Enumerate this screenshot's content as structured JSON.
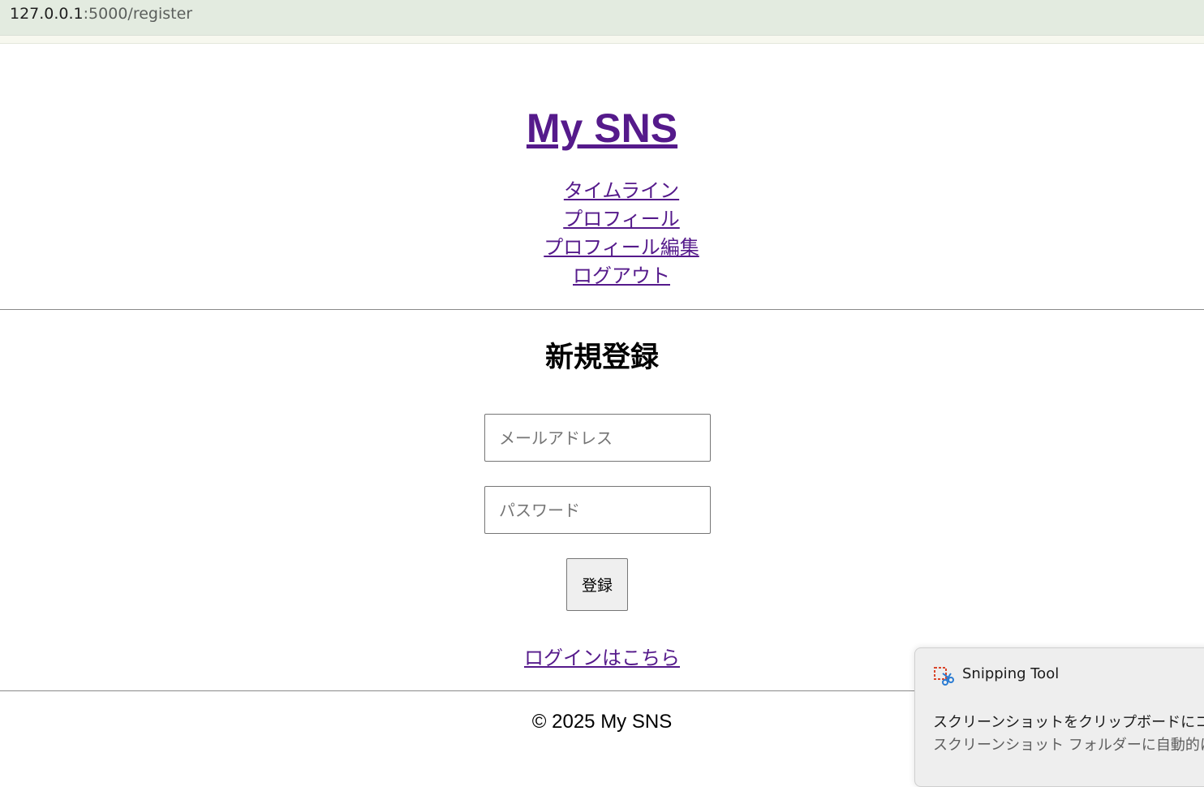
{
  "browser": {
    "url_host": "127.0.0.1",
    "url_path": ":5000/register"
  },
  "site": {
    "title": "My SNS"
  },
  "nav": {
    "items": [
      "タイムライン",
      "プロフィール",
      "プロフィール編集",
      "ログアウト"
    ]
  },
  "register": {
    "heading": "新規登録",
    "email_placeholder": "メールアドレス",
    "password_placeholder": "パスワード",
    "submit_label": "登録",
    "login_link": "ログインはこちら"
  },
  "footer": {
    "text": "© 2025 My SNS"
  },
  "notification": {
    "app_name": "Snipping Tool",
    "line1": "スクリーンショットをクリップボードにコピーしま",
    "line2": "スクリーンショット フォルダーに自動的に保"
  },
  "colors": {
    "link": "#551a8b",
    "urlbar": "#e3ebe0"
  }
}
